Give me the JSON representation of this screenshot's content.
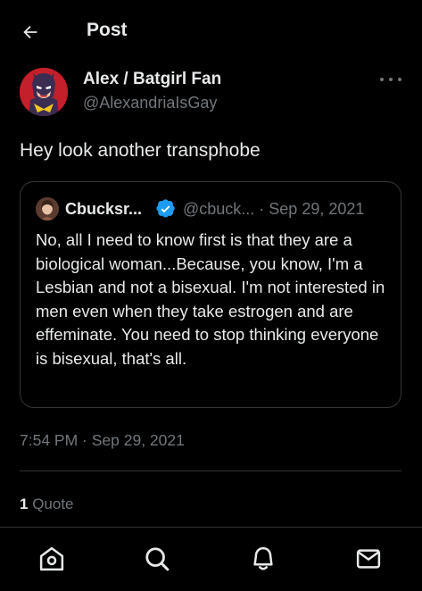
{
  "header": {
    "back_icon": "arrow-left-icon",
    "title": "Post"
  },
  "author": {
    "display_name": "Alex / Batgirl Fan",
    "handle": "@AlexandriaIsGay",
    "avatar_icon": "batgirl-avatar"
  },
  "tweet": {
    "text": "Hey look another transphobe"
  },
  "quote": {
    "name": "Cbucksr...",
    "handle_date": "@cbuck... · Sep 29, 2021",
    "verified_icon": "verified-badge-icon",
    "text": "No, all I need to know first is that they are a biological woman...Because, you know, I'm a Lesbian and not a bisexual. I'm not interested in men even when they take estrogen and are effeminate. You need to stop thinking everyone is bisexual, that's all."
  },
  "meta": {
    "timestamp": "7:54 PM · Sep 29, 2021"
  },
  "stats": {
    "quote_count": "1",
    "quote_label": "Quote"
  },
  "nav": {
    "items": [
      "home-icon",
      "search-icon",
      "notifications-bell-icon",
      "messages-envelope-icon"
    ]
  },
  "colors": {
    "background": "#000000",
    "text_primary": "#e7e9ea",
    "text_secondary": "#71767b",
    "border": "#2f3336",
    "verified_blue": "#1d9bf0"
  }
}
